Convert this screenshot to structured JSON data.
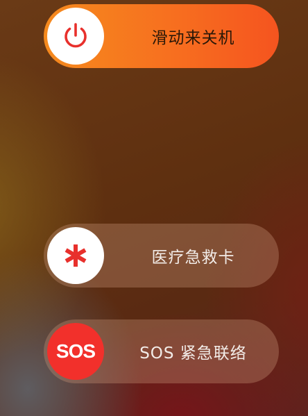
{
  "power_off_slider": {
    "icon": "power-icon",
    "label": "滑动来关机"
  },
  "medical_id_slider": {
    "icon": "asterisk-icon",
    "label": "医疗急救卡"
  },
  "sos_slider": {
    "knob_text": "SOS",
    "label": "SOS 紧急联络"
  },
  "colors": {
    "power_gradient_start": "#f58a1e",
    "power_gradient_end": "#f5541f",
    "icon_red": "#e8302c",
    "sos_red": "#f2302b"
  }
}
